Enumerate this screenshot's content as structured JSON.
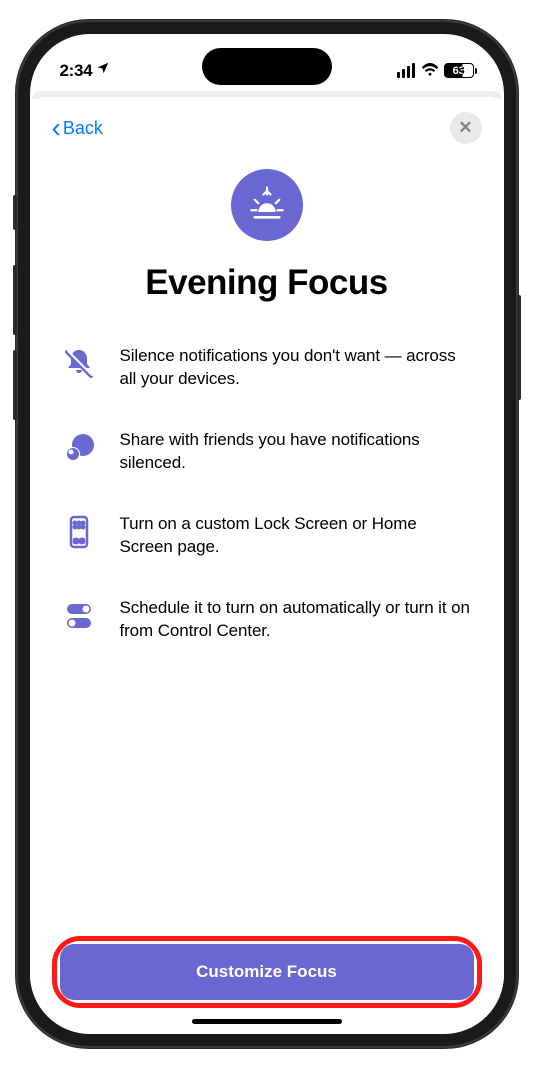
{
  "status": {
    "time": "2:34",
    "battery": "63"
  },
  "header": {
    "back_label": "Back"
  },
  "title": "Evening Focus",
  "features": [
    {
      "text": "Silence notifications you don't want — across all your devices."
    },
    {
      "text": "Share with friends you have notifications silenced."
    },
    {
      "text": "Turn on a custom Lock Screen or Home Screen page."
    },
    {
      "text": "Schedule it to turn on automatically or turn it on from Control Center."
    }
  ],
  "cta": {
    "label": "Customize Focus"
  },
  "colors": {
    "accent": "#6967d2",
    "link": "#007aff",
    "highlight": "#ff1a1a"
  }
}
